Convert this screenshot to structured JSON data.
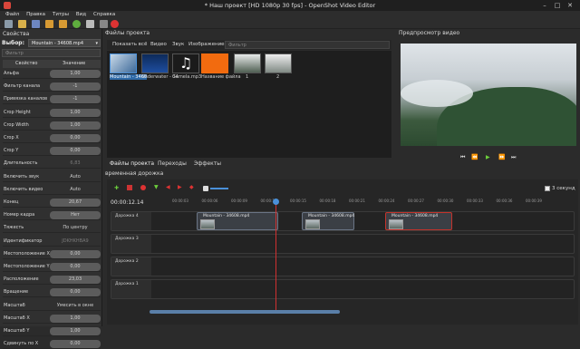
{
  "window": {
    "title": "* Наш проект [HD 1080p 30 fps] - OpenShot Video Editor"
  },
  "menu": [
    "Файл",
    "Правка",
    "Титры",
    "Вид",
    "Справка"
  ],
  "properties": {
    "title": "Свойства",
    "select_label": "Выбор:",
    "selected": "Mountain - 34608.mp4",
    "filter_placeholder": "Фильтр",
    "col_property": "Свойство",
    "col_value": "Значение",
    "rows": [
      {
        "name": "Альфа",
        "value": "1,00"
      },
      {
        "name": "Фильтр канала",
        "value": "-1"
      },
      {
        "name": "Привязка каналов",
        "value": "-1"
      },
      {
        "name": "Crop Height",
        "value": "1,00"
      },
      {
        "name": "Crop Width",
        "value": "1,00"
      },
      {
        "name": "Crop X",
        "value": "0,00"
      },
      {
        "name": "Crop Y",
        "value": "0,00"
      },
      {
        "name": "Длительность",
        "value": "6,83"
      },
      {
        "name": "Включить звук",
        "value": "Auto"
      },
      {
        "name": "Включить видео",
        "value": "Auto"
      },
      {
        "name": "Конец",
        "value": "20,67"
      },
      {
        "name": "Номер кадра",
        "value": "Нет"
      },
      {
        "name": "Тяжесть",
        "value": "По центру"
      },
      {
        "name": "Идентификатор",
        "value": "JDKHKHBA9"
      },
      {
        "name": "Местоположение X",
        "value": "0,00"
      },
      {
        "name": "Местоположение Y",
        "value": "0,00"
      },
      {
        "name": "Расположение",
        "value": "23,03"
      },
      {
        "name": "Вращение",
        "value": "0,00"
      },
      {
        "name": "Масштаб",
        "value": "Умесить в окне"
      },
      {
        "name": "Масштаб X",
        "value": "1,00"
      },
      {
        "name": "Масштаб Y",
        "value": "1,00"
      },
      {
        "name": "Сдвинуть по X",
        "value": "0,00"
      }
    ]
  },
  "files": {
    "title": "Файлы проекта",
    "filters": [
      "Показать всё",
      "Видео",
      "Звук",
      "Изображение"
    ],
    "filter_placeholder": "Фильтр",
    "items": [
      {
        "label": "Mountain - 3460"
      },
      {
        "label": "Underwater - 34"
      },
      {
        "label": "Gamela.mp3"
      },
      {
        "label": "Название файла"
      },
      {
        "label": "1"
      },
      {
        "label": "2"
      }
    ],
    "tabs": [
      "Файлы проекта",
      "Переходы",
      "Эффекты"
    ]
  },
  "preview": {
    "title": "Предпросмотр видео",
    "controls": [
      "⏮",
      "⏪",
      "▶",
      "⏩",
      "⏭"
    ]
  },
  "timeline": {
    "title": "временная дорожка",
    "timecode": "00:00:12.14",
    "zoom_label": "3 секунд",
    "ticks": [
      "00:00:03",
      "00:00:06",
      "00:00:09",
      "00:00:12",
      "00:00:15",
      "00:00:18",
      "00:00:21",
      "00:00:24",
      "00:00:27",
      "00:00:30",
      "00:00:33",
      "00:00:36",
      "00:00:39"
    ],
    "tracks": [
      "Дорожка 4",
      "Дорожка 3",
      "Дорожка 2",
      "Дорожка 1"
    ],
    "clips": [
      "Mountain - 34608.mp4",
      "Mountain - 34608.mp4",
      "Mountain - 34608.mp4"
    ]
  },
  "colors": {
    "accent": "#c3332b",
    "playhead": "#d03030",
    "selection": "#4a90d9"
  }
}
